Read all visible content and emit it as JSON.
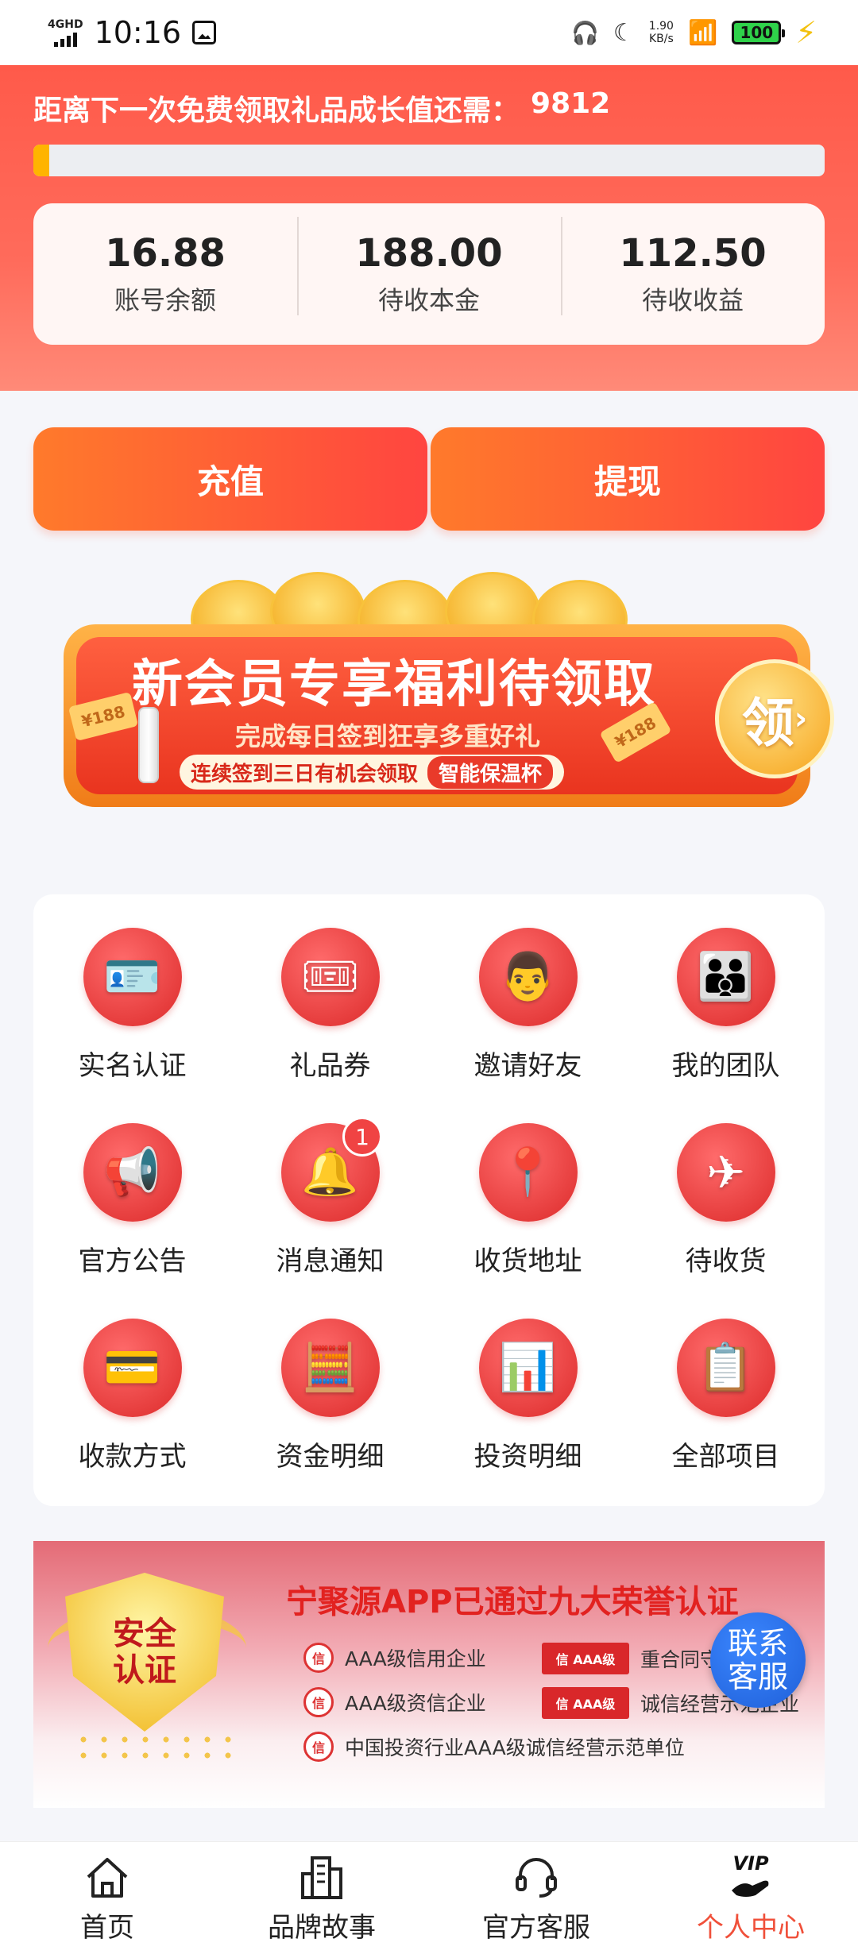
{
  "status_bar": {
    "network": "4GHD",
    "time": "10:16",
    "speed_value": "1.90",
    "speed_unit": "KB/s",
    "battery": "100"
  },
  "growth": {
    "text": "距离下一次免费领取礼品成长值还需：",
    "value": "9812",
    "progress_percent": 2
  },
  "stats": [
    {
      "value": "16.88",
      "label": "账号余额"
    },
    {
      "value": "188.00",
      "label": "待收本金"
    },
    {
      "value": "112.50",
      "label": "待收收益"
    }
  ],
  "actions": {
    "recharge": "充值",
    "withdraw": "提现"
  },
  "promo": {
    "title": "新会员专享福利待领取",
    "subtitle": "完成每日签到狂享多重好礼",
    "tag": "连续签到三日有机会领取",
    "tag_pill": "智能保温杯",
    "button": "领",
    "ticket_left": "¥188",
    "ticket_right": "¥188"
  },
  "grid": [
    {
      "label": "实名认证",
      "icon": "id-card-icon",
      "glyph": "🪪"
    },
    {
      "label": "礼品券",
      "icon": "coupon-icon",
      "glyph": "🎟"
    },
    {
      "label": "邀请好友",
      "icon": "invite-user-icon",
      "glyph": "👨"
    },
    {
      "label": "我的团队",
      "icon": "team-icon",
      "glyph": "👪"
    },
    {
      "label": "官方公告",
      "icon": "announcement-icon",
      "glyph": "📢"
    },
    {
      "label": "消息通知",
      "icon": "bell-icon",
      "glyph": "🔔",
      "badge": "1"
    },
    {
      "label": "收货地址",
      "icon": "map-pin-icon",
      "glyph": "📍"
    },
    {
      "label": "待收货",
      "icon": "plane-package-icon",
      "glyph": "✈"
    },
    {
      "label": "收款方式",
      "icon": "bank-card-icon",
      "glyph": "💳"
    },
    {
      "label": "资金明细",
      "icon": "calculator-icon",
      "glyph": "🧮"
    },
    {
      "label": "投资明细",
      "icon": "chart-icon",
      "glyph": "📊"
    },
    {
      "label": "全部项目",
      "icon": "clipboard-icon",
      "glyph": "📋"
    }
  ],
  "cert": {
    "shield_text": "安全认证",
    "title": "宁聚源APP已通过九大荣誉认证",
    "items": [
      "AAA级信用企业",
      "重合同守信用企业",
      "AAA级资信企业",
      "诚信经营示范企业",
      "中国投资行业AAA级诚信经营示范单位"
    ],
    "seal_text": "信",
    "seal_badge_text": "AAA级"
  },
  "contact": {
    "label": "联系客服"
  },
  "tabs": [
    {
      "label": "首页",
      "icon": "home-icon"
    },
    {
      "label": "品牌故事",
      "icon": "buildings-icon"
    },
    {
      "label": "官方客服",
      "icon": "headset-icon"
    },
    {
      "label": "个人中心",
      "icon": "vip-hand-icon",
      "badge": "VIP"
    }
  ],
  "colors": {
    "accent": "#f0503a",
    "header": "#ff5a4a",
    "contact": "#1f5fd8"
  }
}
